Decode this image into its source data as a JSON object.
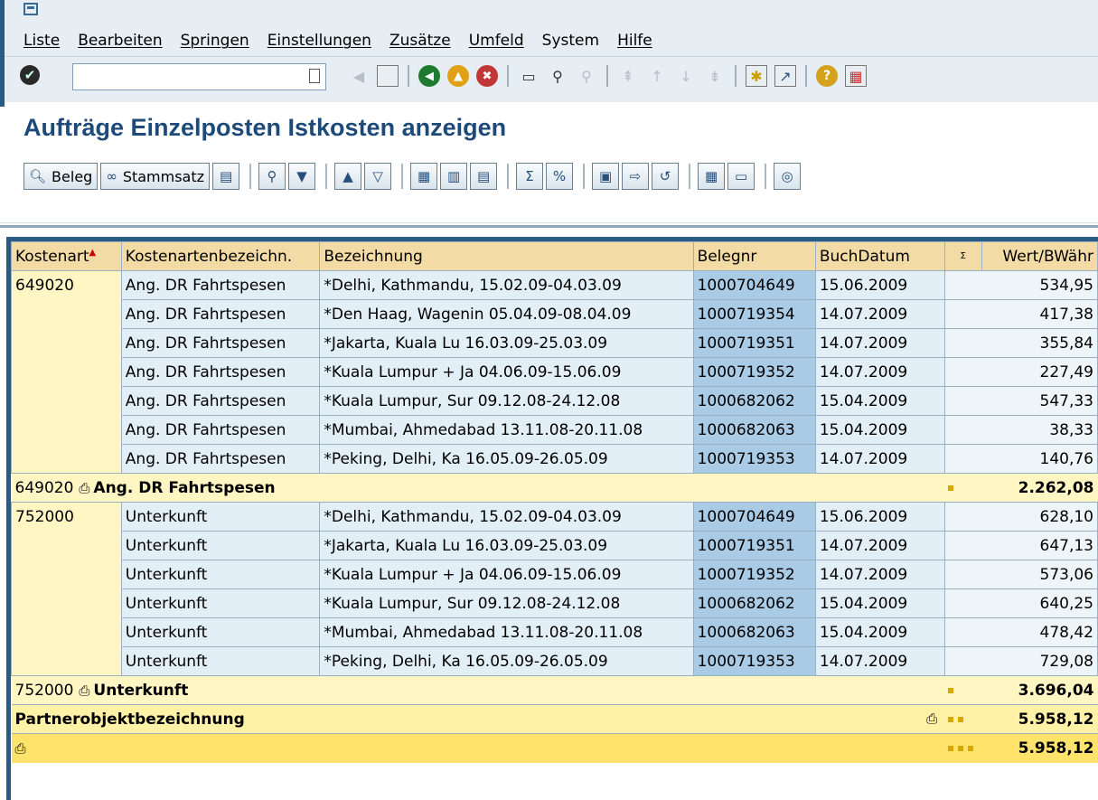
{
  "menu": [
    "Liste",
    "Bearbeiten",
    "Springen",
    "Einstellungen",
    "Zusätze",
    "Umfeld",
    "System",
    "Hilfe"
  ],
  "page_title": "Aufträge Einzelposten Istkosten anzeigen",
  "toolbar2": {
    "beleg_label": "Beleg",
    "stammsatz_label": "Stammsatz"
  },
  "columns": [
    "Kostenart",
    "Kostenartenbezeichn.",
    "Bezeichnung",
    "Belegnr",
    "BuchDatum",
    "Σ",
    "Wert/BWähr"
  ],
  "group1": {
    "kostenart": "649020",
    "rows": [
      [
        "Ang. DR Fahrtspesen",
        "*Delhi, Kathmandu, 15.02.09-04.03.09",
        "1000704649",
        "15.06.2009",
        "534,95"
      ],
      [
        "Ang. DR Fahrtspesen",
        "*Den Haag, Wagenin 05.04.09-08.04.09",
        "1000719354",
        "14.07.2009",
        "417,38"
      ],
      [
        "Ang. DR Fahrtspesen",
        "*Jakarta, Kuala Lu 16.03.09-25.03.09",
        "1000719351",
        "14.07.2009",
        "355,84"
      ],
      [
        "Ang. DR Fahrtspesen",
        "*Kuala Lumpur + Ja 04.06.09-15.06.09",
        "1000719352",
        "14.07.2009",
        "227,49"
      ],
      [
        "Ang. DR Fahrtspesen",
        "*Kuala Lumpur, Sur 09.12.08-24.12.08",
        "1000682062",
        "15.04.2009",
        "547,33"
      ],
      [
        "Ang. DR Fahrtspesen",
        "*Mumbai, Ahmedabad 13.11.08-20.11.08",
        "1000682063",
        "15.04.2009",
        "38,33"
      ],
      [
        "Ang. DR Fahrtspesen",
        "*Peking, Delhi, Ka 16.05.09-26.05.09",
        "1000719353",
        "14.07.2009",
        "140,76"
      ]
    ],
    "subtotal_kostenart": "649020",
    "subtotal_label": "Ang. DR Fahrtspesen",
    "subtotal_value": "2.262,08"
  },
  "group2": {
    "kostenart": "752000",
    "rows": [
      [
        "Unterkunft",
        "*Delhi, Kathmandu, 15.02.09-04.03.09",
        "1000704649",
        "15.06.2009",
        "628,10"
      ],
      [
        "Unterkunft",
        "*Jakarta, Kuala Lu 16.03.09-25.03.09",
        "1000719351",
        "14.07.2009",
        "647,13"
      ],
      [
        "Unterkunft",
        "*Kuala Lumpur + Ja 04.06.09-15.06.09",
        "1000719352",
        "14.07.2009",
        "573,06"
      ],
      [
        "Unterkunft",
        "*Kuala Lumpur, Sur 09.12.08-24.12.08",
        "1000682062",
        "15.04.2009",
        "640,25"
      ],
      [
        "Unterkunft",
        "*Mumbai, Ahmedabad 13.11.08-20.11.08",
        "1000682063",
        "15.04.2009",
        "478,42"
      ],
      [
        "Unterkunft",
        "*Peking, Delhi, Ka 16.05.09-26.05.09",
        "1000719353",
        "14.07.2009",
        "729,08"
      ]
    ],
    "subtotal_kostenart": "752000",
    "subtotal_label": "Unterkunft",
    "subtotal_value": "3.696,04"
  },
  "partner_label": "Partnerobjektbezeichnung",
  "partner_value": "5.958,12",
  "grand_value": "5.958,12"
}
